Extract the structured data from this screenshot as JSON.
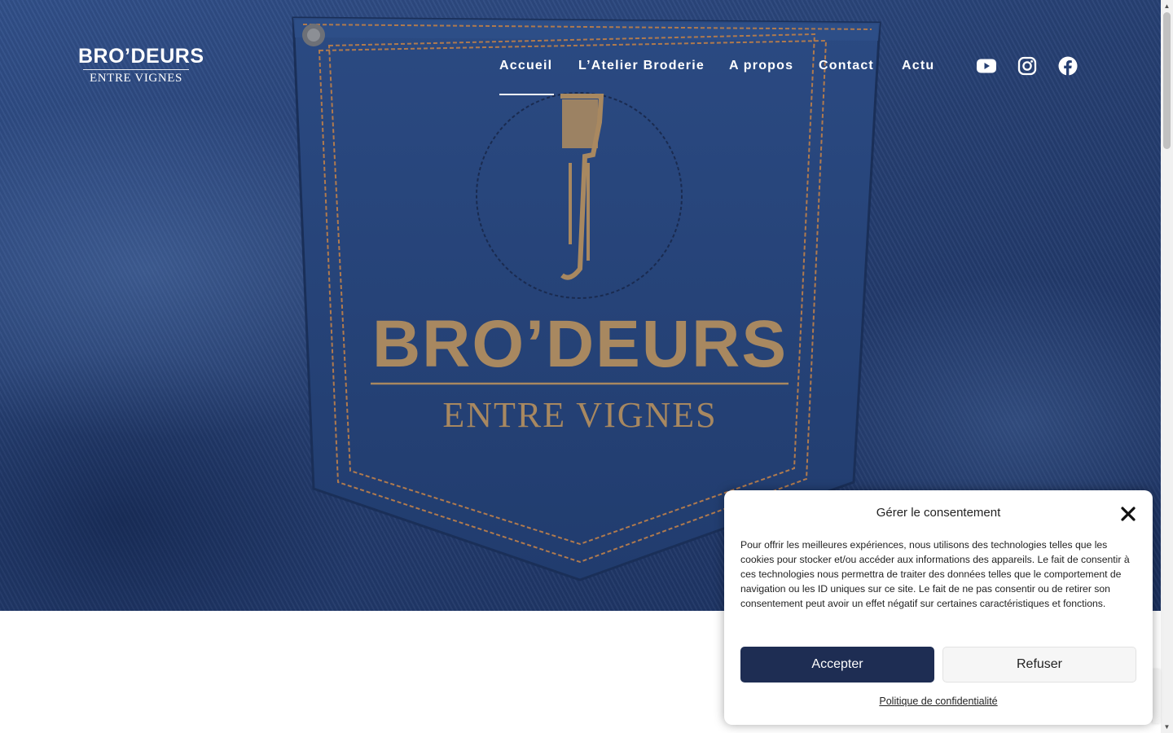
{
  "logo": {
    "line1": "BRO’DEURS",
    "line2": "ENTRE VIGNES"
  },
  "hero": {
    "pocket_logo": {
      "line1": "BRO’DEURS",
      "line2": "ENTRE VIGNES"
    }
  },
  "nav": {
    "items": [
      {
        "label": "Accueil",
        "active": true
      },
      {
        "label": "L’Atelier Broderie"
      },
      {
        "label": "A propos"
      },
      {
        "label": "Contact"
      },
      {
        "label": "Actu"
      }
    ]
  },
  "social": [
    "youtube-icon",
    "instagram-icon",
    "facebook-icon"
  ],
  "consent": {
    "title": "Gérer le consentement",
    "text": "Pour offrir les meilleures expériences, nous utilisons des technologies telles que les cookies pour stocker et/ou accéder aux informations des appareils. Le fait de consentir à ces technologies nous permettra de traiter des données telles que le comportement de navigation ou les ID uniques sur ce site. Le fait de ne pas consentir ou de retirer son consentement peut avoir un effet négatif sur certaines caractéristiques et fonctions.",
    "accept_label": "Accepter",
    "refuse_label": "Refuser",
    "policy_link": "Politique de confidentialité"
  },
  "colors": {
    "accept_bg": "#1e2d53",
    "denim": "#263f72",
    "embroidery": "#a88860"
  }
}
